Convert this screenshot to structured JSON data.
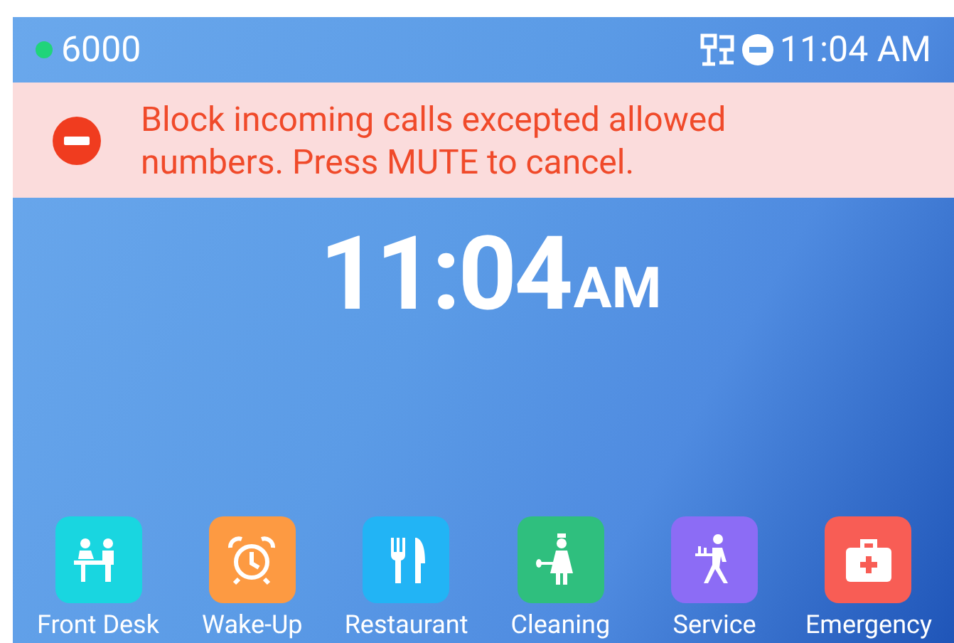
{
  "status_bar": {
    "account": "6000",
    "account_registered": true,
    "time": "11:04 AM"
  },
  "banner": {
    "message": "Block incoming calls excepted allowed numbers. Press MUTE to cancel."
  },
  "clock": {
    "time": "11:04",
    "meridiem": "AM"
  },
  "apps": [
    {
      "label": "Front Desk",
      "kind": "desk",
      "color": "#19d6e0"
    },
    {
      "label": "Wake-Up",
      "kind": "alarm",
      "color": "#fd9a42"
    },
    {
      "label": "Restaurant",
      "kind": "food",
      "color": "#22b4f5"
    },
    {
      "label": "Cleaning",
      "kind": "cleaning",
      "color": "#2fbf7e"
    },
    {
      "label": "Service",
      "kind": "service",
      "color": "#8c6cf5"
    },
    {
      "label": "Emergency",
      "kind": "emergency",
      "color": "#f85d55"
    }
  ]
}
